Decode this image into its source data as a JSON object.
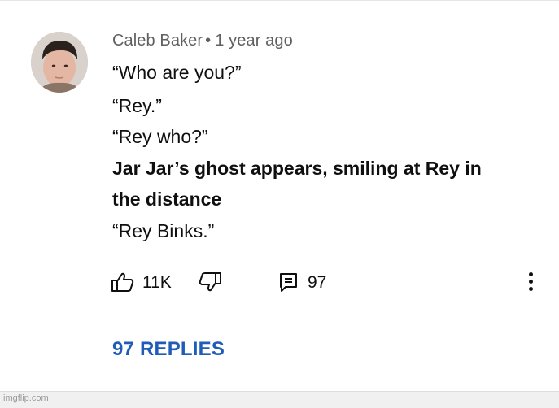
{
  "comment": {
    "author": "Caleb Baker",
    "separator": "•",
    "timestamp": "1 year ago",
    "lines": [
      "“Who are you?”",
      "“Rey.”",
      "“Rey who?”",
      "Jar Jar’s ghost appears, smiling at Rey in",
      "the distance",
      "“Rey Binks.”"
    ]
  },
  "actions": {
    "like_icon": "thumbs-up-icon",
    "like_count": "11K",
    "dislike_icon": "thumbs-down-icon",
    "reply_icon": "comment-icon",
    "reply_count": "97",
    "more_icon": "more-vertical-icon"
  },
  "replies": {
    "label": "97 REPLIES",
    "color": "#1f5bb8"
  },
  "watermark": "imgflip.com"
}
